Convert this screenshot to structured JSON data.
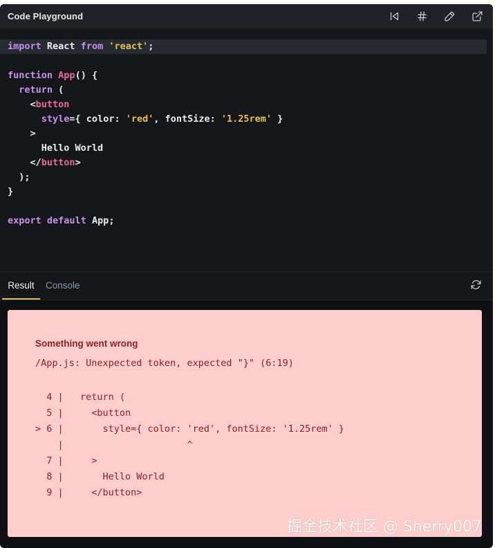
{
  "header": {
    "title": "Code Playground",
    "tools": [
      {
        "icon": "skip-back-icon"
      },
      {
        "icon": "hash-icon"
      },
      {
        "icon": "pencil-icon"
      },
      {
        "icon": "external-link-icon"
      }
    ]
  },
  "editor": {
    "lines": [
      [
        {
          "t": "import",
          "c": "kw"
        },
        {
          "t": " React ",
          "c": "pl"
        },
        {
          "t": "from",
          "c": "kw"
        },
        {
          "t": " ",
          "c": "pl"
        },
        {
          "t": "'react'",
          "c": "str"
        },
        {
          "t": ";",
          "c": "pl"
        }
      ],
      [],
      [
        {
          "t": "function",
          "c": "kw"
        },
        {
          "t": " ",
          "c": "pl"
        },
        {
          "t": "App",
          "c": "fn"
        },
        {
          "t": "() {",
          "c": "pl"
        }
      ],
      [
        {
          "t": "  ",
          "c": "pl"
        },
        {
          "t": "return",
          "c": "kw"
        },
        {
          "t": " (",
          "c": "pl"
        }
      ],
      [
        {
          "t": "    <",
          "c": "pl"
        },
        {
          "t": "button",
          "c": "tag"
        }
      ],
      [
        {
          "t": "      ",
          "c": "pl"
        },
        {
          "t": "style",
          "c": "kw"
        },
        {
          "t": "={ color: ",
          "c": "pl"
        },
        {
          "t": "'red'",
          "c": "str"
        },
        {
          "t": ", fontSize: ",
          "c": "pl"
        },
        {
          "t": "'1.25rem'",
          "c": "str"
        },
        {
          "t": " }",
          "c": "pl"
        }
      ],
      [
        {
          "t": "    >",
          "c": "pl"
        }
      ],
      [
        {
          "t": "      Hello World",
          "c": "pl"
        }
      ],
      [
        {
          "t": "    </",
          "c": "pl"
        },
        {
          "t": "button",
          "c": "tag"
        },
        {
          "t": ">",
          "c": "pl"
        }
      ],
      [
        {
          "t": "  );",
          "c": "pl"
        }
      ],
      [
        {
          "t": "}",
          "c": "pl"
        }
      ],
      [],
      [
        {
          "t": "export",
          "c": "kw"
        },
        {
          "t": " ",
          "c": "pl"
        },
        {
          "t": "default",
          "c": "kw"
        },
        {
          "t": " App;",
          "c": "pl"
        }
      ]
    ],
    "active_line": 0
  },
  "tabs": {
    "result": "Result",
    "console": "Console",
    "refresh_icon": "refresh-icon"
  },
  "error": {
    "title": "Something went wrong",
    "message": "/App.js: Unexpected token, expected \"}\" (6:19)",
    "frame": [
      "  4 |   return (",
      "  5 |     <button",
      "> 6 |       style={ color: 'red', fontSize: '1.25rem' }",
      "    |                      ^",
      "  7 |     >",
      "  8 |       Hello World",
      "  9 |     </button>"
    ]
  },
  "watermark": "掘金技术社区 @ Sherry007",
  "colors": {
    "keyword": "#c792ea",
    "function": "#e76a9b",
    "string": "#e6c14c",
    "error_bg": "#ffcdcc",
    "error_text": "#8c2121",
    "tab_active": "#e6c14c"
  }
}
